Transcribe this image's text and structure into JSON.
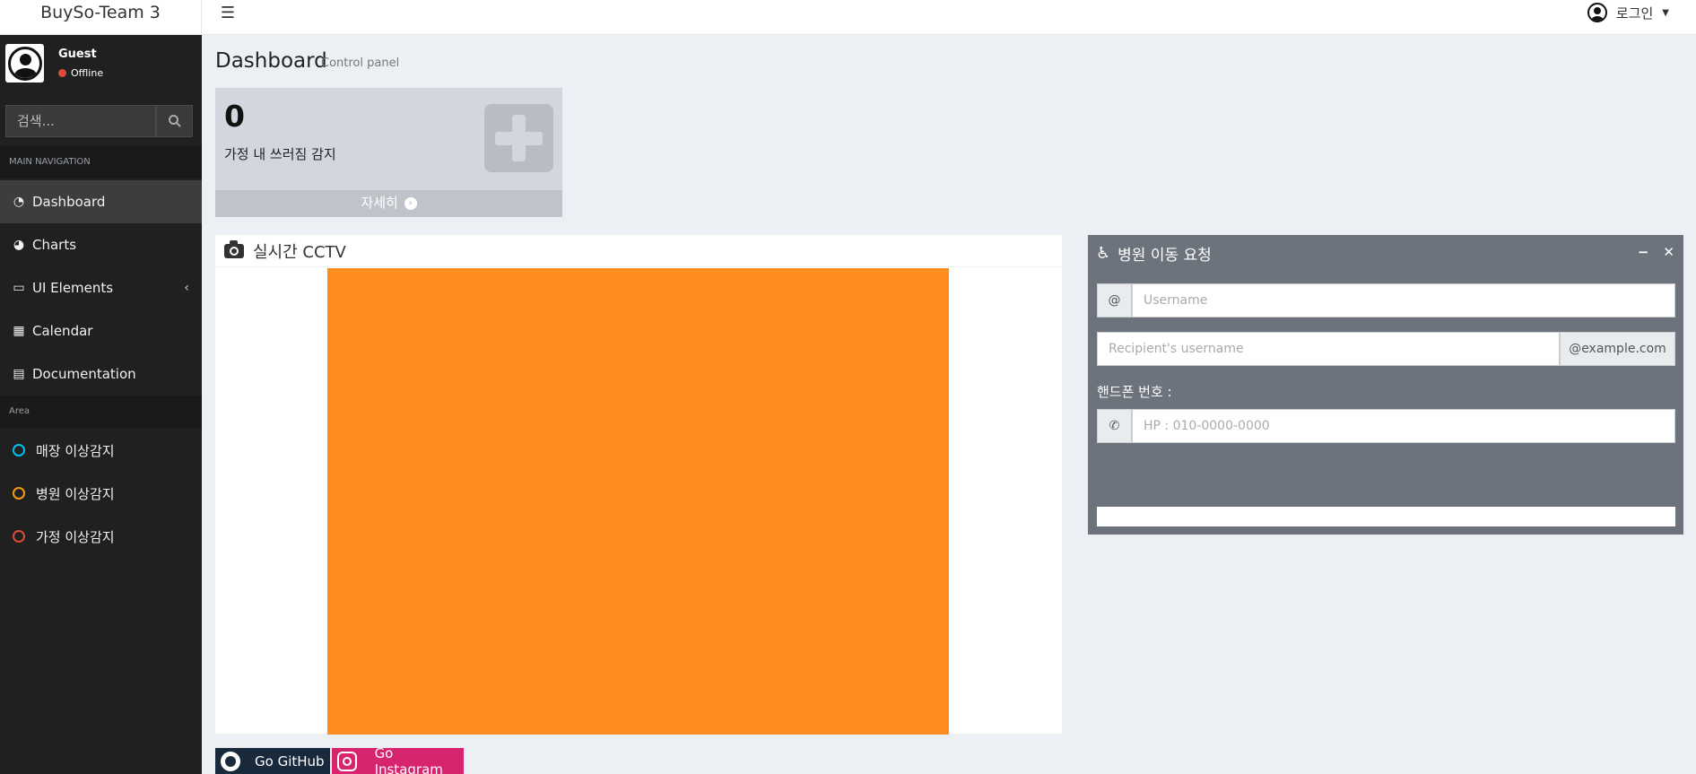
{
  "header": {
    "brand": "BuySo-Team 3",
    "login_label": "로그인"
  },
  "sidebar": {
    "user_name": "Guest",
    "user_status": "Offline",
    "search_placeholder": "검색...",
    "main_nav_header": "MAIN NAVIGATION",
    "items": [
      {
        "label": "Dashboard",
        "icon": "dashboard-icon",
        "active": true
      },
      {
        "label": "Charts",
        "icon": "pie-chart-icon"
      },
      {
        "label": "UI Elements",
        "icon": "laptop-icon"
      },
      {
        "label": "Calendar",
        "icon": "calendar-icon"
      },
      {
        "label": "Documentation",
        "icon": "book-icon"
      }
    ],
    "area_header": "Area",
    "areas": [
      {
        "label": "매장 이상감지",
        "color": "#00c0ef"
      },
      {
        "label": "병원 이상감지",
        "color": "#f39c12"
      },
      {
        "label": "가정 이상감지",
        "color": "#dd4b39"
      }
    ]
  },
  "main": {
    "title": "Dashboard",
    "subtitle": "Control panel",
    "stat": {
      "value": "0",
      "label": "가정 내 쓰러짐 감지",
      "footer": "자세히"
    },
    "cctv": {
      "title": "실시간 CCTV"
    },
    "request": {
      "title": "병원 이동 요청",
      "at_addon": "@",
      "username_placeholder": "Username",
      "recipient_placeholder": "Recipient's username",
      "email_addon": "@example.com",
      "phone_label": "핸드폰 번호 :",
      "phone_placeholder": "HP : 010-0000-0000"
    }
  },
  "footer": {
    "github_label": "Go GitHub",
    "instagram_label": "Go Instagram"
  },
  "colors": {
    "sidebar_bg": "#202020",
    "cctv_feed": "#ff8c1f",
    "request_box": "#6c737c",
    "github": "#192a3c",
    "instagram": "#d6246f"
  }
}
